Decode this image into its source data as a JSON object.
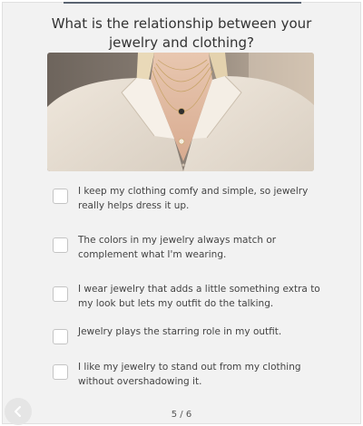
{
  "question": {
    "title": "What is the relationship between your jewelry and clothing?"
  },
  "hero_image": {
    "description": "woman wearing a cream button-up shirt and layered pendant necklaces"
  },
  "options": [
    {
      "label": "I keep my clothing comfy and simple, so jewelry really helps dress it up.",
      "checked": false
    },
    {
      "label": "The colors in my jewelry always match or complement what I'm wearing.",
      "checked": false
    },
    {
      "label": "I wear jewelry that adds a little something extra to my look but lets my outfit do the talking.",
      "checked": false
    },
    {
      "label": "Jewelry plays the starring role in my outfit.",
      "checked": false
    },
    {
      "label": "I like my jewelry to stand out from my clothing without overshadowing it.",
      "checked": false
    }
  ],
  "navigation": {
    "back_icon": "chevron-left-icon",
    "progress": "5 / 6"
  },
  "colors": {
    "background": "#f2f2f2",
    "text": "#333333",
    "accent_rule": "#5a6472"
  }
}
